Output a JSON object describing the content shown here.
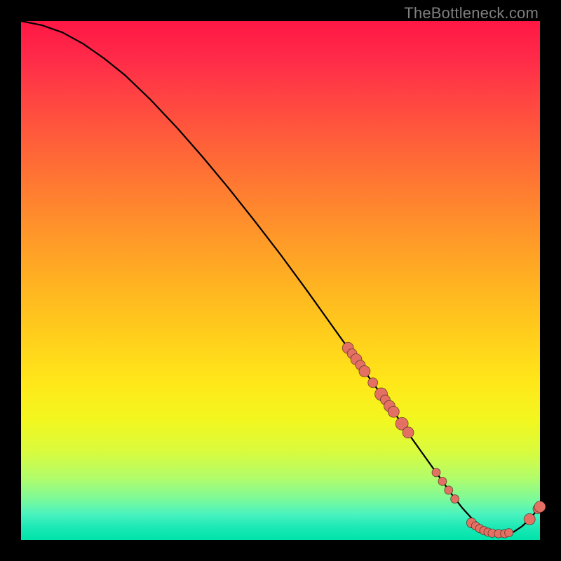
{
  "watermark": "TheBottleneck.com",
  "colors": {
    "marker_fill": "#e37063",
    "curve_stroke": "#000000"
  },
  "chart_data": {
    "type": "line",
    "title": "",
    "xlabel": "",
    "ylabel": "",
    "xlim": [
      0,
      100
    ],
    "ylim": [
      0,
      100
    ],
    "grid": false,
    "legend": false,
    "series": [
      {
        "name": "curve",
        "x": [
          0,
          4,
          8,
          12,
          16,
          20,
          25,
          30,
          35,
          40,
          45,
          50,
          55,
          60,
          63,
          65,
          67,
          69,
          71,
          73,
          75,
          77,
          79,
          81,
          83,
          85,
          87,
          89,
          90.5,
          92,
          93.5,
          95,
          96.5,
          98,
          99,
          100
        ],
        "y": [
          100,
          99.2,
          97.8,
          95.6,
          92.8,
          89.6,
          84.8,
          79.5,
          73.8,
          67.8,
          61.5,
          55.0,
          48.2,
          41.2,
          37.0,
          34.2,
          31.4,
          28.6,
          25.8,
          23.0,
          20.0,
          17.2,
          14.4,
          11.6,
          8.8,
          6.2,
          4.0,
          2.4,
          1.6,
          1.2,
          1.2,
          1.6,
          2.6,
          4.0,
          5.2,
          6.4
        ]
      }
    ],
    "markers": [
      {
        "x": 63.0,
        "y": 37.0,
        "r": 8
      },
      {
        "x": 63.8,
        "y": 35.9,
        "r": 7
      },
      {
        "x": 64.6,
        "y": 34.8,
        "r": 8
      },
      {
        "x": 65.4,
        "y": 33.7,
        "r": 7
      },
      {
        "x": 66.2,
        "y": 32.5,
        "r": 8
      },
      {
        "x": 67.8,
        "y": 30.3,
        "r": 7
      },
      {
        "x": 69.4,
        "y": 28.1,
        "r": 9
      },
      {
        "x": 70.2,
        "y": 27.0,
        "r": 7
      },
      {
        "x": 71.0,
        "y": 25.8,
        "r": 8
      },
      {
        "x": 71.8,
        "y": 24.7,
        "r": 8
      },
      {
        "x": 73.4,
        "y": 22.4,
        "r": 9
      },
      {
        "x": 74.6,
        "y": 20.7,
        "r": 8
      },
      {
        "x": 80.0,
        "y": 13.0,
        "r": 6
      },
      {
        "x": 81.2,
        "y": 11.3,
        "r": 6
      },
      {
        "x": 82.4,
        "y": 9.6,
        "r": 6
      },
      {
        "x": 83.6,
        "y": 7.9,
        "r": 6
      },
      {
        "x": 86.8,
        "y": 3.3,
        "r": 7
      },
      {
        "x": 87.6,
        "y": 2.7,
        "r": 6
      },
      {
        "x": 88.4,
        "y": 2.2,
        "r": 6
      },
      {
        "x": 89.2,
        "y": 1.8,
        "r": 6
      },
      {
        "x": 90.0,
        "y": 1.5,
        "r": 6
      },
      {
        "x": 90.8,
        "y": 1.3,
        "r": 6
      },
      {
        "x": 92.0,
        "y": 1.2,
        "r": 6
      },
      {
        "x": 93.2,
        "y": 1.2,
        "r": 6
      },
      {
        "x": 94.0,
        "y": 1.4,
        "r": 6
      },
      {
        "x": 98.0,
        "y": 4.0,
        "r": 8
      },
      {
        "x": 99.6,
        "y": 6.0,
        "r": 7
      },
      {
        "x": 100.0,
        "y": 6.4,
        "r": 8
      }
    ]
  }
}
